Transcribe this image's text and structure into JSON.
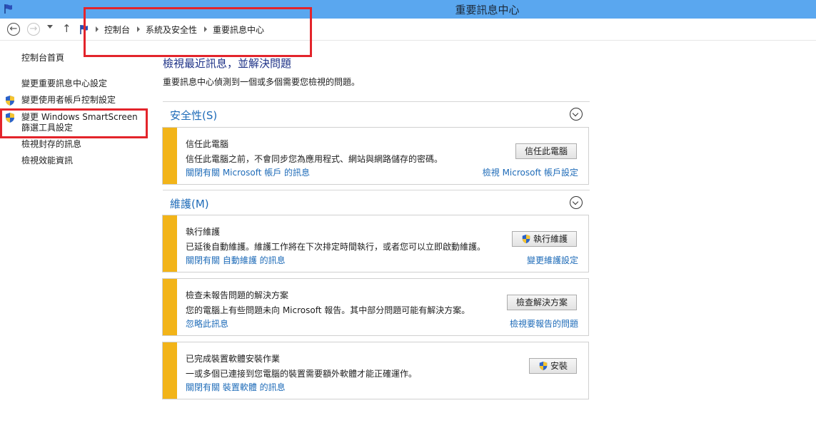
{
  "window": {
    "title": "重要訊息中心"
  },
  "breadcrumb": {
    "items": [
      "控制台",
      "系統及安全性",
      "重要訊息中心"
    ]
  },
  "sidebar": {
    "home": "控制台首頁",
    "links": [
      {
        "label": "變更重要訊息中心設定",
        "shield": false
      },
      {
        "label": "變更使用者帳戶控制設定",
        "shield": true
      },
      {
        "label_line1": "變更 Windows SmartScreen",
        "label_line2": "篩選工具設定",
        "shield": true
      },
      {
        "label": "檢視封存的訊息",
        "shield": false
      },
      {
        "label": "檢視效能資訊",
        "shield": false
      }
    ]
  },
  "main": {
    "heading": "檢視最近訊息，並解決問題",
    "subheading": "重要訊息中心偵測到一個或多個需要您檢視的問題。",
    "sections": [
      {
        "label": "安全性(S)",
        "cards": [
          {
            "title": "信任此電腦",
            "description": "信任此電腦之前，不會同步您為應用程式、網站與網路儲存的密碼。",
            "link": "關閉有關 Microsoft 帳戶 的訊息",
            "right_link": "檢視 Microsoft 帳戶設定",
            "button": "信任此電腦",
            "button_shield": false
          }
        ]
      },
      {
        "label": "維護(M)",
        "cards": [
          {
            "title": "執行維護",
            "description": "已延後自動維護。維護工作將在下次排定時間執行，或者您可以立即啟動維護。",
            "link": "關閉有關 自動維護 的訊息",
            "right_link": "變更維護設定",
            "button": "執行維護",
            "button_shield": true
          },
          {
            "title": "檢查未報告問題的解決方案",
            "description": "您的電腦上有些問題未向 Microsoft 報告。其中部分問題可能有解決方案。",
            "link": "忽略此訊息",
            "right_link": "檢視要報告的問題",
            "button": "檢查解決方案",
            "button_shield": false
          },
          {
            "title": "已完成裝置軟體安裝作業",
            "description": "一或多個已連接到您電腦的裝置需要額外軟體才能正確運作。",
            "link": "關閉有關 裝置軟體 的訊息",
            "right_link": "",
            "button": "安裝",
            "button_shield": true
          }
        ]
      }
    ]
  },
  "colors": {
    "titlebar": "#5aa7ef",
    "stripe": "#f2b419",
    "link": "#1e6bb8",
    "heading": "#1e3287",
    "annotation": "#e3242b"
  }
}
